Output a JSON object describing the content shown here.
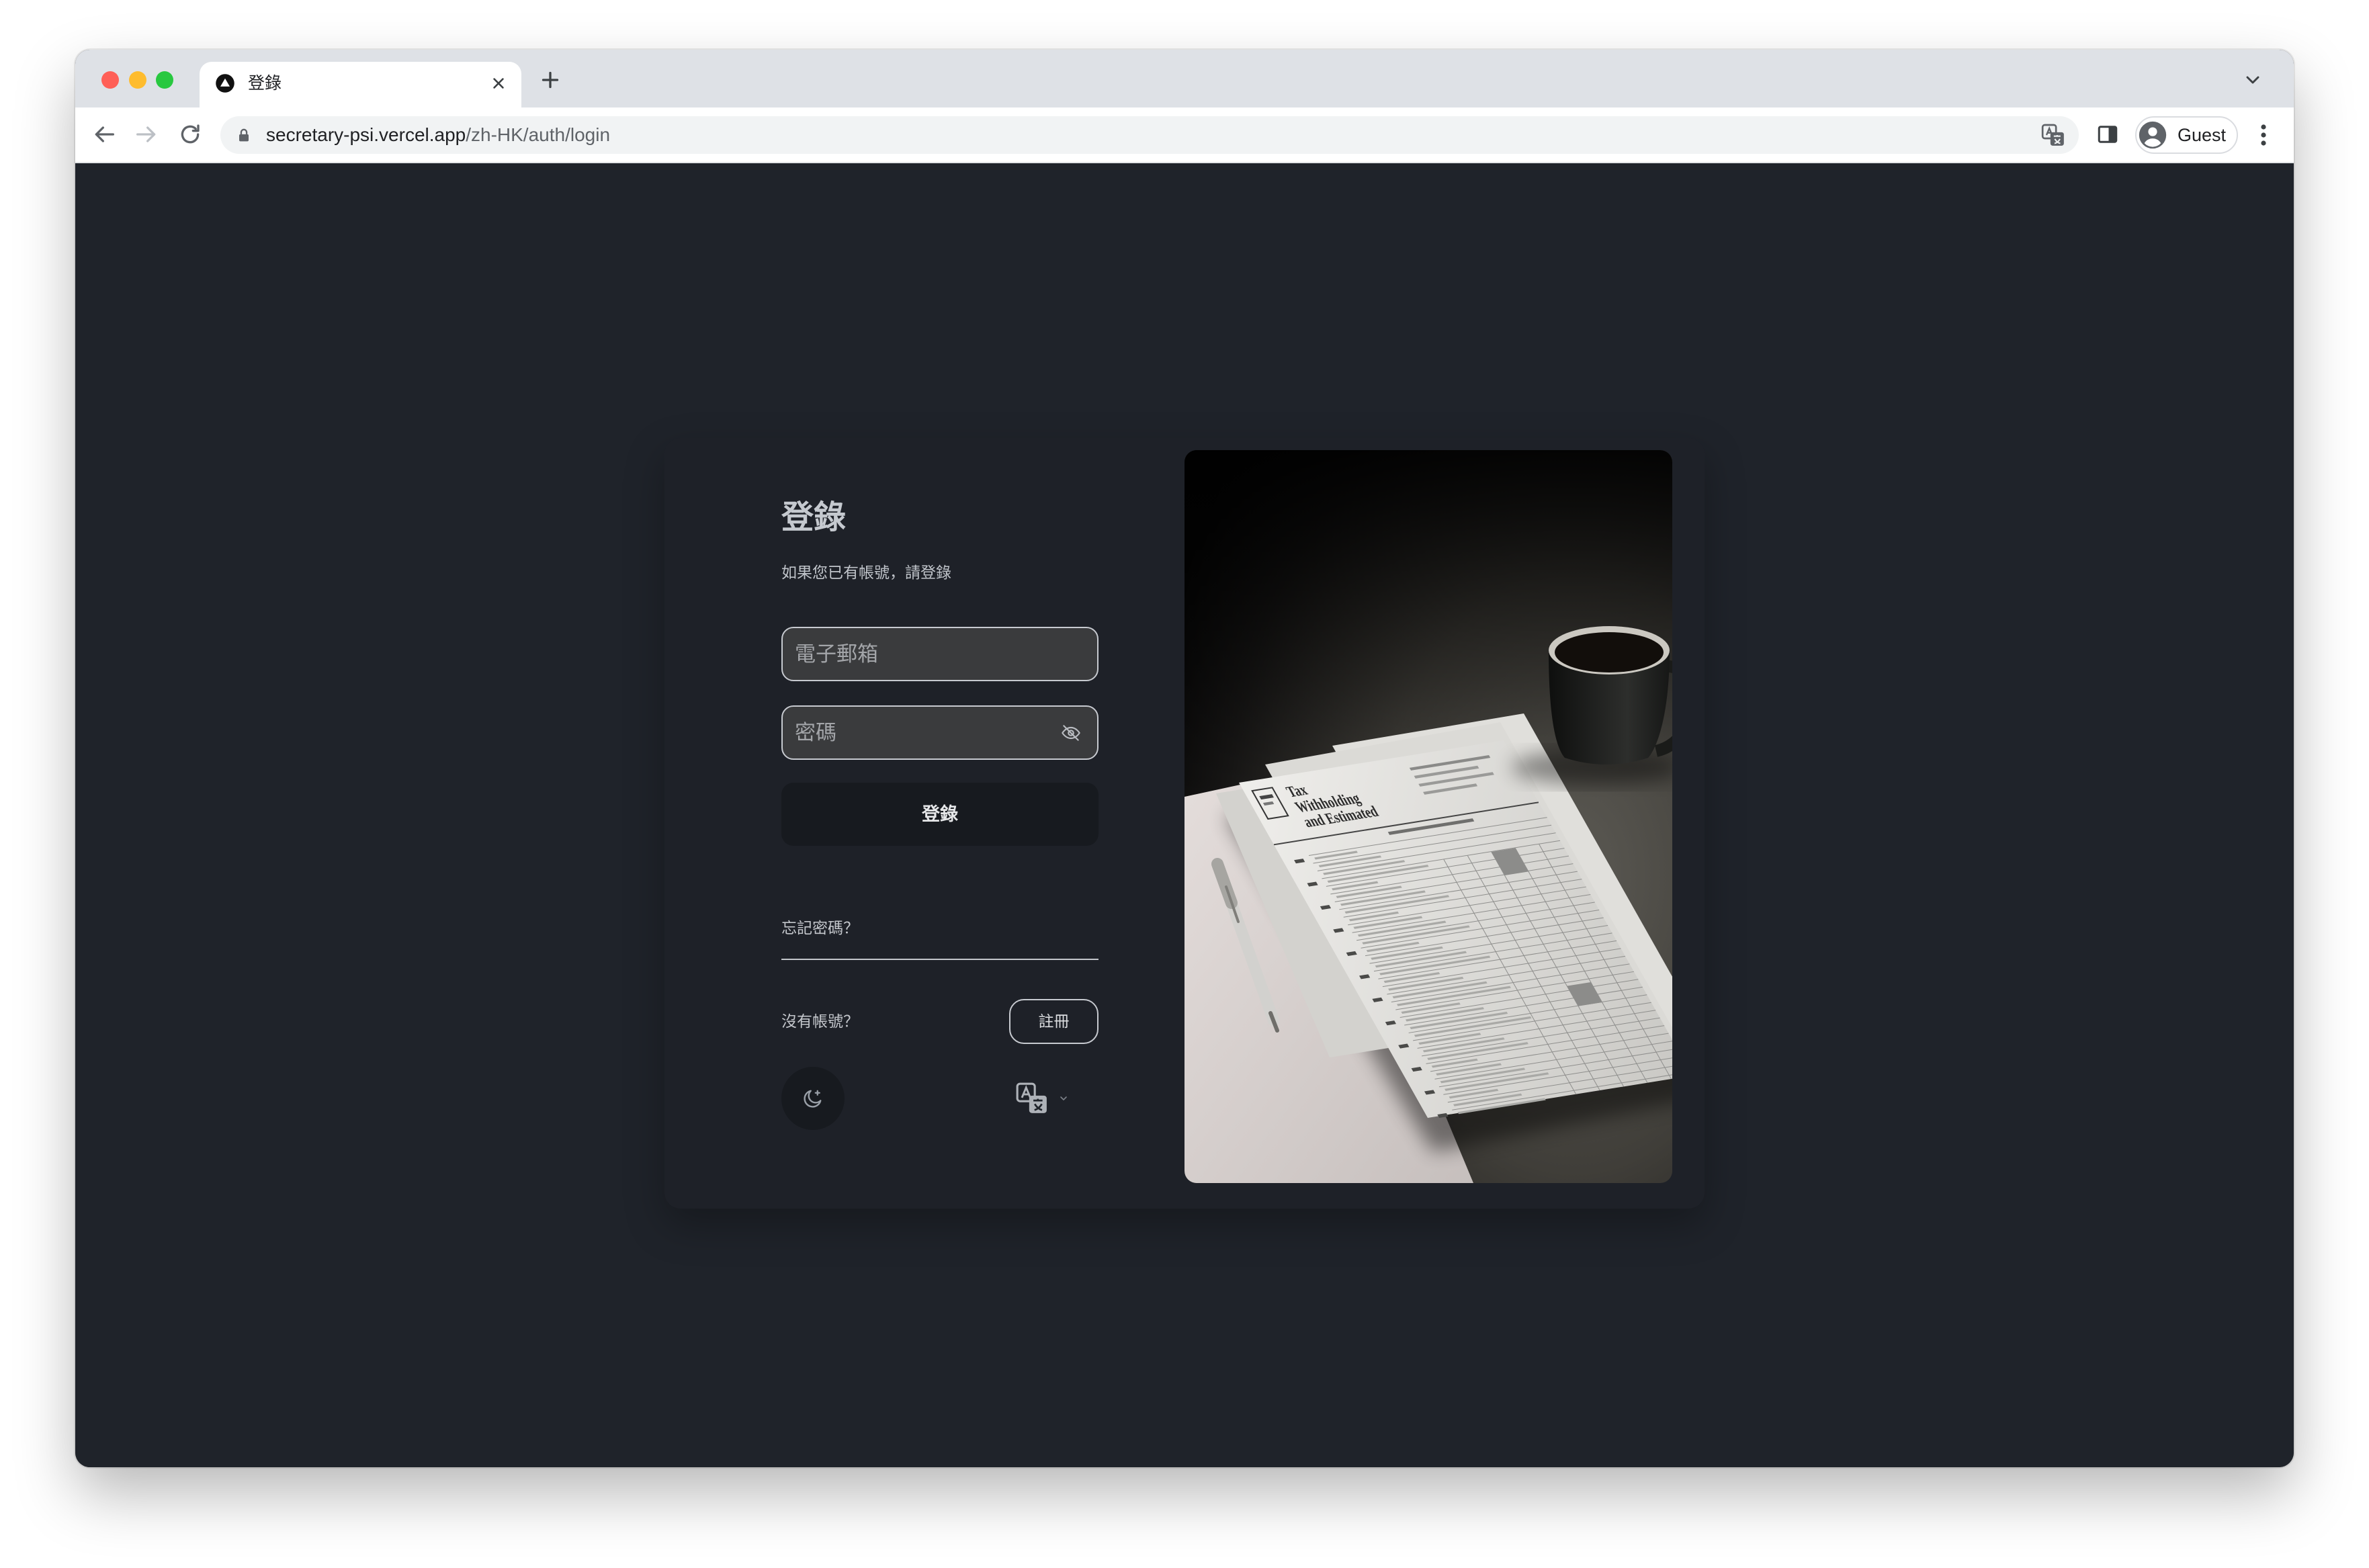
{
  "browser": {
    "tab": {
      "title": "登錄",
      "favicon_icon": "triangle-logo-icon",
      "close_icon": "close-icon"
    },
    "new_tab_icon": "plus-icon",
    "tab_search_icon": "chevron-down-icon",
    "nav": {
      "back_icon": "arrow-left-icon",
      "forward_icon": "arrow-right-icon",
      "reload_icon": "reload-icon"
    },
    "address": {
      "lock_icon": "lock-icon",
      "host": "secretary-psi.vercel.app",
      "path": "/zh-HK/auth/login",
      "translate_icon": "translate-page-icon"
    },
    "side_panel_icon": "side-panel-icon",
    "profile": {
      "avatar_icon": "avatar-icon",
      "label": "Guest"
    },
    "menu_icon": "kebab-menu-icon"
  },
  "login": {
    "title": "登錄",
    "subtitle": "如果您已有帳號，請登錄",
    "email": {
      "placeholder": "電子郵箱"
    },
    "password": {
      "placeholder": "密碼",
      "toggle_icon": "eye-off-icon"
    },
    "submit_label": "登錄",
    "forgot_password": "忘記密碼？",
    "no_account": "沒有帳號？",
    "register_label": "註冊",
    "theme_toggle_icon": "moon-icon",
    "language_icon": "translate-icon",
    "language_chevron_icon": "chevron-down-icon"
  },
  "photo": {
    "paper_title_lines": [
      "Tax",
      "Withholding",
      "and Estimated"
    ]
  },
  "colors": {
    "page_background": "#1f232a",
    "card_background": "#1e2128",
    "input_background": "#3a3b3d",
    "input_border": "#c7cad0",
    "button_background": "#171a1f",
    "text_primary": "#c5c9cf",
    "browser_chrome": "#dee1e6",
    "traffic_red": "#ff5f57",
    "traffic_yellow": "#febc2e",
    "traffic_green": "#28c840"
  }
}
